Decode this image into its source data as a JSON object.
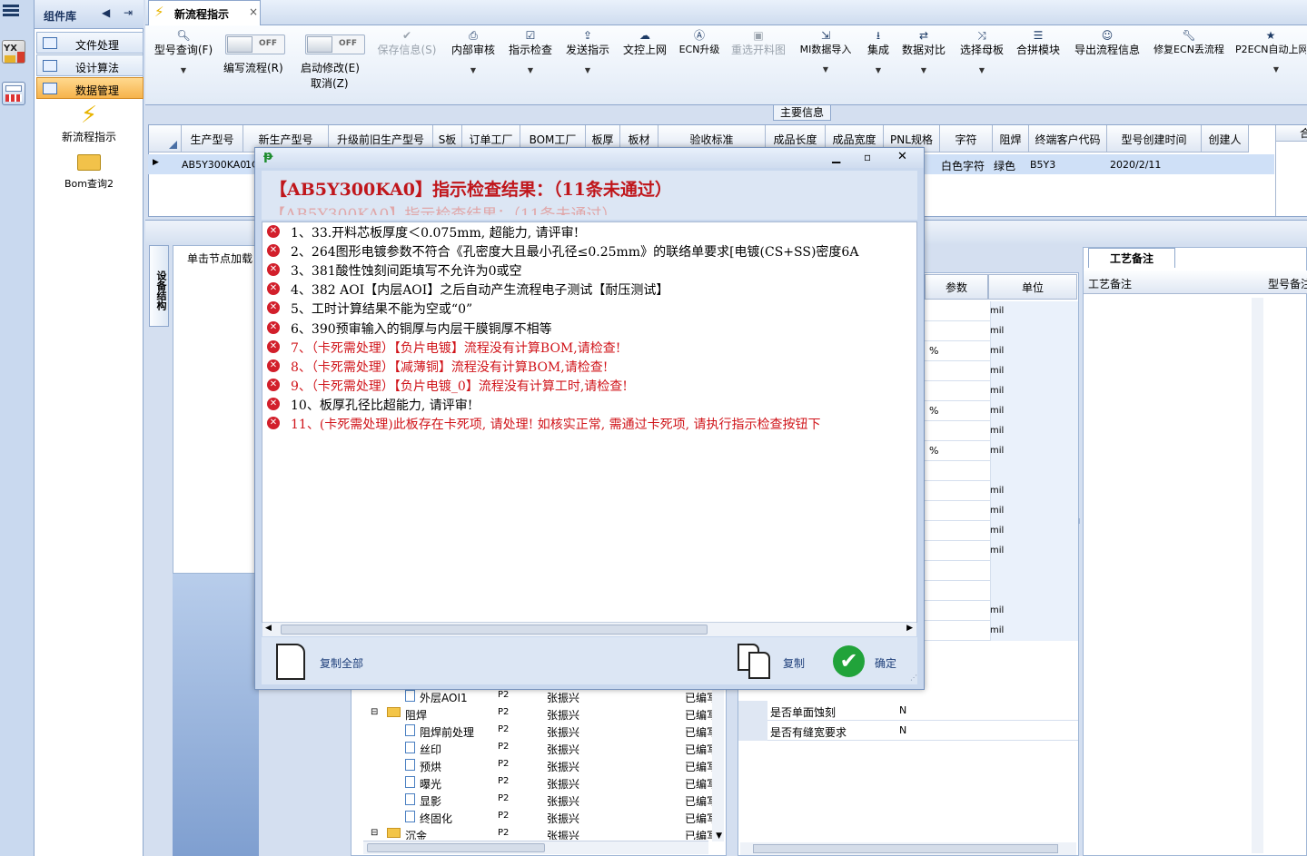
{
  "left_panel": {
    "title": "组件库",
    "items": [
      "文件处理",
      "设计算法",
      "数据管理"
    ],
    "shortcuts": [
      "新流程指示",
      "Bom查询2"
    ]
  },
  "tab": {
    "title": "新流程指示",
    "close": "×"
  },
  "toolbar": {
    "items": [
      {
        "label": "型号查询(F)",
        "icon": "search-icon",
        "disabled": false,
        "dropdown": true
      },
      {
        "label": "保存信息(S)",
        "icon": "check-icon",
        "disabled": true,
        "dropdown": false
      },
      {
        "label": "内部审核",
        "icon": "printer-icon",
        "disabled": false,
        "dropdown": true
      },
      {
        "label": "指示检查",
        "icon": "checklist-icon",
        "disabled": false,
        "dropdown": true
      },
      {
        "label": "发送指示",
        "icon": "upload-icon",
        "disabled": false,
        "dropdown": true
      },
      {
        "label": "文控上网",
        "icon": "cloud-upload-icon",
        "disabled": false,
        "dropdown": false
      },
      {
        "label": "ECN升级",
        "icon": "ecn-icon",
        "disabled": false,
        "dropdown": false
      },
      {
        "label": "重选开料图",
        "icon": "image-icon",
        "disabled": true,
        "dropdown": false
      },
      {
        "label": "MI数据导入",
        "icon": "import-icon",
        "disabled": false,
        "dropdown": true
      },
      {
        "label": "集成",
        "icon": "download-icon",
        "disabled": false,
        "dropdown": true
      },
      {
        "label": "数据对比",
        "icon": "compare-icon",
        "disabled": false,
        "dropdown": true
      },
      {
        "label": "选择母板",
        "icon": "shuffle-icon",
        "disabled": false,
        "dropdown": true
      },
      {
        "label": "合拼模块",
        "icon": "list-icon",
        "disabled": false,
        "dropdown": false
      },
      {
        "label": "导出流程信息",
        "icon": "smile-icon",
        "disabled": false,
        "dropdown": false
      },
      {
        "label": "修复ECN丢流程",
        "icon": "wrench-icon",
        "disabled": false,
        "dropdown": false
      },
      {
        "label": "P2ECN自动上网",
        "icon": "star-icon",
        "disabled": false,
        "dropdown": true
      }
    ],
    "toggles": [
      {
        "label": "编写流程(R)",
        "state": "OFF"
      },
      {
        "label": "启动修改(E)",
        "state": "OFF",
        "extra": "取消(Z)"
      }
    ]
  },
  "main_info": {
    "label": "主要信息",
    "columns": [
      "生产型号",
      "新生产型号",
      "升级前旧生产型号",
      "S板",
      "订单工厂",
      "BOM工厂",
      "板厚",
      "板材",
      "验收标准",
      "成品长度",
      "成品宽度",
      "PNL规格",
      "字符",
      "阻焊",
      "终端客户代码",
      "型号创建时间",
      "创建人"
    ],
    "row": {
      "生产型号": "AB5Y300KA0",
      "新生产型号": "1C",
      "字符": "白色字符",
      "阻焊": "绿色",
      "终端客户代码": "B5Y3",
      "型号创建时间": "2020/2/11"
    },
    "right_header": "合"
  },
  "left_lower": {
    "vtab": "设备结构",
    "hint": "单击节点加载"
  },
  "tree": {
    "rows": [
      {
        "name": "外层AOI1",
        "code": "P2",
        "person": "张振兴",
        "status": "已编写",
        "type": "file",
        "depth": 2
      },
      {
        "name": "阻焊",
        "code": "P2",
        "person": "张振兴",
        "status": "已编写",
        "type": "folder",
        "depth": 1
      },
      {
        "name": "阻焊前处理",
        "code": "P2",
        "person": "张振兴",
        "status": "已编写",
        "type": "file",
        "depth": 2
      },
      {
        "name": "丝印",
        "code": "P2",
        "person": "张振兴",
        "status": "已编写",
        "type": "file",
        "depth": 2
      },
      {
        "name": "预烘",
        "code": "P2",
        "person": "张振兴",
        "status": "已编写",
        "type": "file",
        "depth": 2
      },
      {
        "name": "曝光",
        "code": "P2",
        "person": "张振兴",
        "status": "已编写",
        "type": "file",
        "depth": 2
      },
      {
        "name": "显影",
        "code": "P2",
        "person": "张振兴",
        "status": "已编写",
        "type": "file",
        "depth": 2
      },
      {
        "name": "终固化",
        "code": "P2",
        "person": "张振兴",
        "status": "已编写",
        "type": "file",
        "depth": 2
      },
      {
        "name": "沉金",
        "code": "P2",
        "person": "张振兴",
        "status": "已编写",
        "type": "folder",
        "depth": 1
      }
    ]
  },
  "params": {
    "headers": [
      "参数",
      "单位"
    ],
    "rows": [
      {
        "unit": "mil",
        "lead": ""
      },
      {
        "unit": "mil",
        "lead": ""
      },
      {
        "unit": "mil",
        "lead": "%"
      },
      {
        "unit": "mil",
        "lead": ""
      },
      {
        "unit": "mil",
        "lead": ""
      },
      {
        "unit": "mil",
        "lead": "%"
      },
      {
        "unit": "mil",
        "lead": ""
      },
      {
        "unit": "mil",
        "lead": "%"
      },
      {
        "unit": "",
        "lead": ""
      },
      {
        "unit": "mil",
        "lead": ""
      },
      {
        "unit": "mil",
        "lead": ""
      },
      {
        "unit": "mil",
        "lead": ""
      },
      {
        "unit": "mil",
        "lead": ""
      },
      {
        "unit": "",
        "lead": ""
      },
      {
        "unit": "",
        "lead": ""
      },
      {
        "unit": "mil",
        "lead": ""
      },
      {
        "unit": "mil",
        "lead": ""
      }
    ],
    "bottom_rows": [
      {
        "name": "是否单面蚀刻",
        "value": "N"
      },
      {
        "name": "是否有缝宽要求",
        "value": "N"
      }
    ]
  },
  "process_notes": {
    "tab": "工艺备注",
    "col1": "工艺备注",
    "col2": "型号备注"
  },
  "dialog": {
    "heading": "【AB5Y300KA0】指示检查结果：（11条未通过）",
    "ghost": "【AB5Y300KA0】指示检查结果：（11条未通过）",
    "results": [
      {
        "text": "1、33.开料芯板厚度＜0.075mm, 超能力, 请评审!",
        "red": false
      },
      {
        "text": "2、264图形电镀参数不符合《孔密度大且最小孔径≤0.25mm》的联络单要求[电镀(CS+SS)密度6A",
        "red": false
      },
      {
        "text": "3、381酸性蚀刻间距填写不允许为0或空",
        "red": false
      },
      {
        "text": "4、382 AOI【内层AOI】之后自动产生流程电子测试【耐压测试】",
        "red": false
      },
      {
        "text": "5、工时计算结果不能为空或“0”",
        "red": false
      },
      {
        "text": "6、390预审输入的铜厚与内层干膜铜厚不相等",
        "red": false
      },
      {
        "text": "7、（卡死需处理）【负片电镀】流程没有计算BOM,请检查!",
        "red": true
      },
      {
        "text": "8、（卡死需处理）【减薄铜】流程没有计算BOM,请检查!",
        "red": true
      },
      {
        "text": "9、（卡死需处理）【负片电镀_0】流程没有计算工时,请检查!",
        "red": true
      },
      {
        "text": "10、板厚孔径比超能力, 请评审!",
        "red": false
      },
      {
        "text": "11、(卡死需处理)此板存在卡死项, 请处理! 如核实正常, 需通过卡死项, 请执行指示检查按钮下",
        "red": true
      }
    ],
    "buttons": {
      "copy_all": "复制全部",
      "copy": "复制",
      "ok": "确定"
    },
    "colors": {
      "heading": "#c0161b",
      "error": "#d21f2b",
      "ok": "#20a030"
    }
  }
}
